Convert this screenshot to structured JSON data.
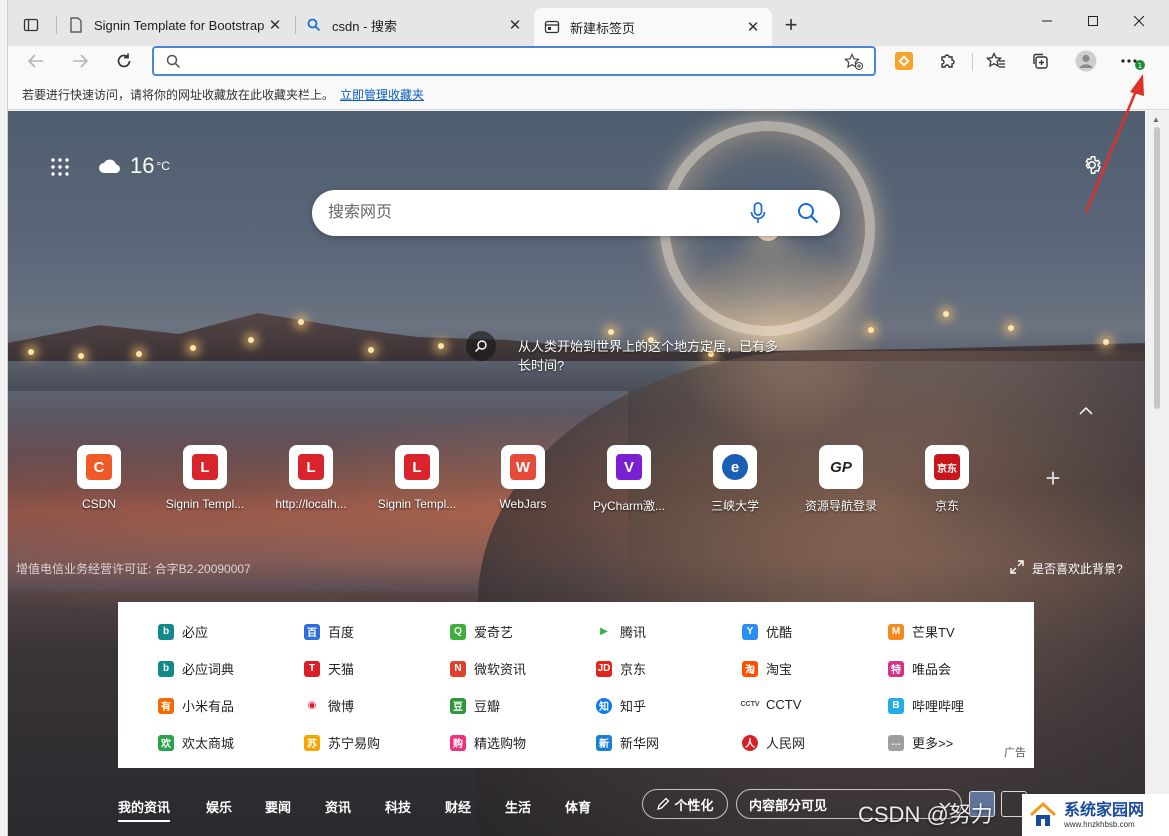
{
  "tabs": [
    {
      "title": "Signin Template for Bootstrap",
      "favicon": "page-icon"
    },
    {
      "title": "csdn - 搜索",
      "favicon": "search-icon"
    },
    {
      "title": "新建标签页",
      "favicon": "newtab-icon",
      "active": true
    }
  ],
  "toolbar": {
    "address_value": "",
    "notification_badge": "1"
  },
  "favorites_bar": {
    "hint": "若要进行快速访问，请将你的网址收藏放在此收藏夹栏上。",
    "manage_link": "立即管理收藏夹"
  },
  "newtab": {
    "temperature": "16",
    "temperature_unit": "°C",
    "weather_icon": "cloud-icon",
    "search_placeholder": "搜索网页",
    "photo_info": "从人类开始到世界上的这个地方定居，已有多长时间?",
    "license": "增值电信业务经营许可证: 合字B2-20090007",
    "like_background": "是否喜欢此背景?",
    "quick_links": [
      {
        "label": "CSDN",
        "glyph": "C",
        "color": "#f05a28"
      },
      {
        "label": "Signin Templ...",
        "glyph": "L",
        "color": "#d9232d"
      },
      {
        "label": "http://localh...",
        "glyph": "L",
        "color": "#d9232d"
      },
      {
        "label": "Signin Templ...",
        "glyph": "L",
        "color": "#d9232d"
      },
      {
        "label": "WebJars",
        "glyph": "W",
        "color": "#e64a3b"
      },
      {
        "label": "PyCharm激...",
        "glyph": "V",
        "color": "#7b1fd2"
      },
      {
        "label": "三峡大学",
        "glyph": "e",
        "color": "#1b5fb5"
      },
      {
        "label": "资源导航登录",
        "glyph": "GP",
        "color": "#222222"
      },
      {
        "label": "京东",
        "glyph": "京东",
        "color": "#c8161d"
      }
    ],
    "links_panel": [
      [
        "必应",
        "百度",
        "爱奇艺",
        "腾讯",
        "优酷",
        "芒果TV"
      ],
      [
        "必应词典",
        "天猫",
        "微软资讯",
        "京东",
        "淘宝",
        "唯品会"
      ],
      [
        "小米有品",
        "微博",
        "豆瓣",
        "知乎",
        "CCTV",
        "哔哩哔哩"
      ],
      [
        "欢太商城",
        "苏宁易购",
        "精选购物",
        "新华网",
        "人民网",
        "更多>>"
      ]
    ],
    "links_panel_ad": "广告",
    "news_tabs": [
      "我的资讯",
      "娱乐",
      "要闻",
      "资讯",
      "科技",
      "财经",
      "生活",
      "体育"
    ],
    "personalize": "个性化",
    "visibility": "内容部分可见"
  },
  "watermark": "CSDN @努力",
  "site_logo": {
    "name": "系统家园网",
    "domain": "www.hnzkhbsb.com"
  },
  "colors": {
    "accent": "#0a5bc4",
    "address_border": "#4a86d8",
    "annotation_arrow": "#e0302a"
  }
}
